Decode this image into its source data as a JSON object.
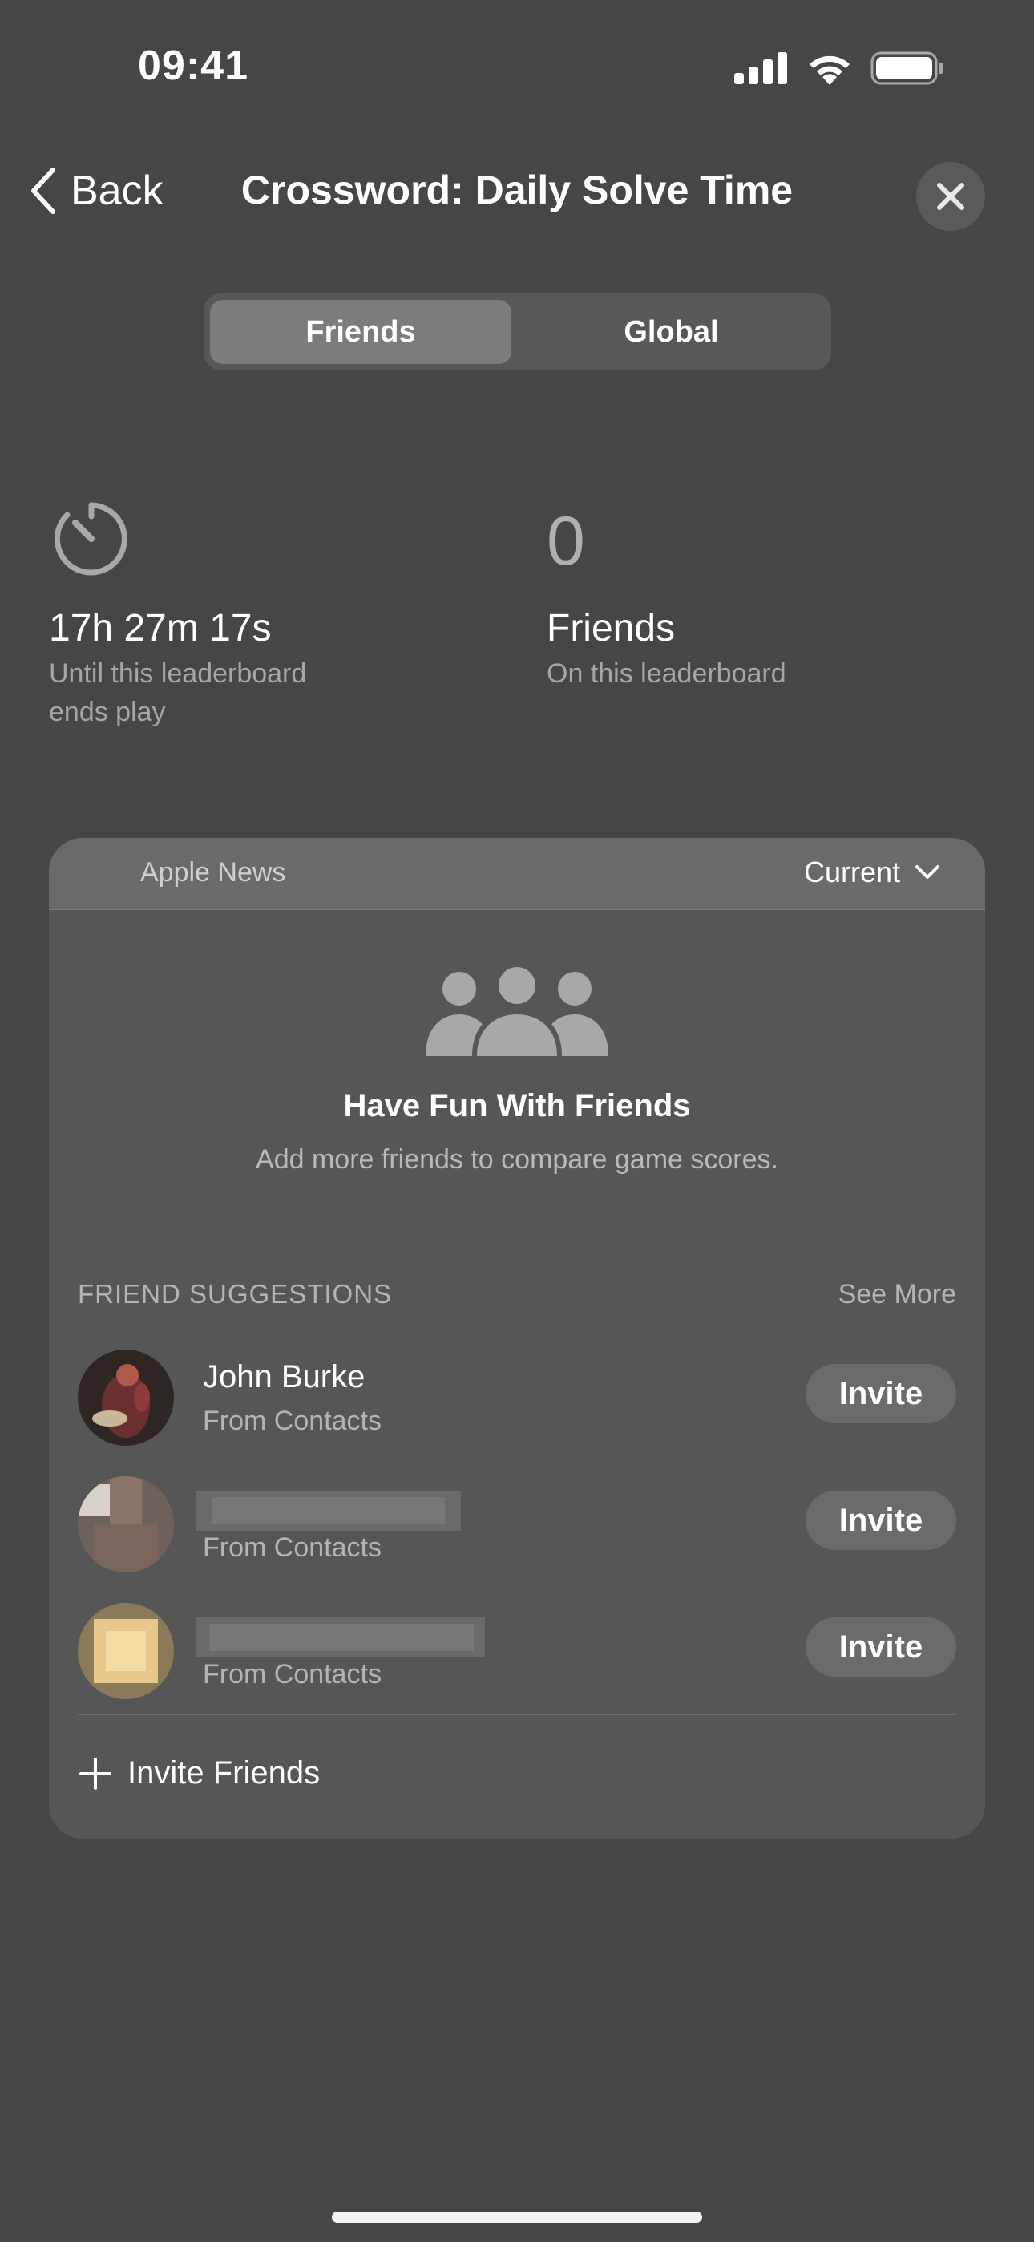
{
  "status_bar": {
    "time": "09:41"
  },
  "nav": {
    "back_label": "Back",
    "title": "Crossword: Daily Solve Time"
  },
  "segments": {
    "friends": "Friends",
    "global": "Global",
    "selected": "Friends"
  },
  "stats": {
    "time_remaining": "17h 27m 17s",
    "time_caption_line1": "Until this leaderboard",
    "time_caption_line2": "ends play",
    "friends_count": "0",
    "friends_label": "Friends",
    "friends_caption": "On this leaderboard"
  },
  "card": {
    "source": "Apple News",
    "period": "Current",
    "empty_title": "Have Fun With Friends",
    "empty_subtitle": "Add more friends to compare game scores.",
    "suggestions_header": "FRIEND SUGGESTIONS",
    "see_more": "See More",
    "suggestions": [
      {
        "name": "John Burke",
        "source": "From Contacts",
        "invite": "Invite"
      },
      {
        "name": "",
        "source": "From Contacts",
        "invite": "Invite"
      },
      {
        "name": "",
        "source": "From Contacts",
        "invite": "Invite"
      }
    ],
    "invite_friends": "Invite Friends"
  }
}
